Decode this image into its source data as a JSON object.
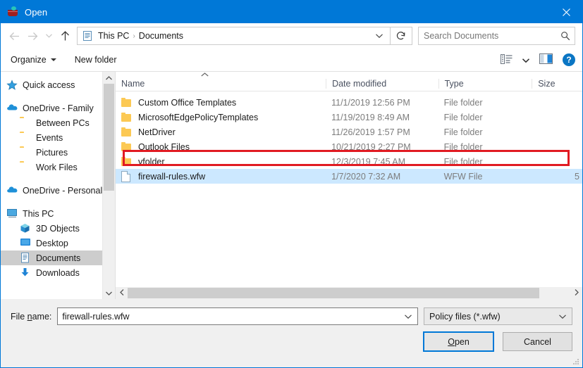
{
  "window": {
    "title": "Open",
    "title_icon": "firewall-basket-icon",
    "close_label": "✕"
  },
  "nav": {
    "back_icon": "back-arrow-icon",
    "forward_icon": "forward-arrow-icon",
    "recent_icon": "chevron-down-icon",
    "up_icon": "up-arrow-icon",
    "breadcrumb_icon": "documents-icon",
    "breadcrumbs": [
      "This PC",
      "Documents"
    ],
    "separator": "›",
    "dropdown_icon": "chevron-down-icon",
    "refresh_icon": "refresh-icon"
  },
  "search": {
    "placeholder": "Search Documents",
    "icon": "search-icon"
  },
  "toolbar": {
    "organize_label": "Organize",
    "new_folder_label": "New folder",
    "view_icon": "view-list-icon",
    "view_caret_icon": "chevron-down-icon",
    "preview_pane_icon": "preview-pane-icon",
    "help_icon": "help-icon",
    "help_glyph": "?"
  },
  "sidebar": {
    "items": [
      {
        "label": "Quick access",
        "icon": "star-icon",
        "indent": false,
        "selected": false
      },
      {
        "label": "OneDrive - Family",
        "icon": "cloud-icon",
        "indent": false,
        "selected": false
      },
      {
        "label": "Between PCs",
        "icon": "folder-icon",
        "indent": true,
        "selected": false
      },
      {
        "label": "Events",
        "icon": "folder-icon",
        "indent": true,
        "selected": false
      },
      {
        "label": "Pictures",
        "icon": "folder-icon",
        "indent": true,
        "selected": false
      },
      {
        "label": "Work Files",
        "icon": "folder-icon",
        "indent": true,
        "selected": false
      },
      {
        "label": "OneDrive - Personal",
        "icon": "cloud-icon",
        "indent": false,
        "selected": false
      },
      {
        "label": "This PC",
        "icon": "monitor-icon",
        "indent": false,
        "selected": false
      },
      {
        "label": "3D Objects",
        "icon": "cube-icon",
        "indent": true,
        "selected": false
      },
      {
        "label": "Desktop",
        "icon": "desktop-icon",
        "indent": true,
        "selected": false
      },
      {
        "label": "Documents",
        "icon": "documents-icon",
        "indent": true,
        "selected": true
      },
      {
        "label": "Downloads",
        "icon": "download-icon",
        "indent": true,
        "selected": false
      }
    ],
    "scroll_up_icon": "chevron-up-icon",
    "scroll_down_icon": "chevron-down-icon"
  },
  "filelist": {
    "sort_indicator_icon": "sort-ascending-icon",
    "columns": [
      "Name",
      "Date modified",
      "Type",
      "Size"
    ],
    "rows": [
      {
        "name": "Custom Office Templates",
        "date": "11/1/2019 12:56 PM",
        "type": "File folder",
        "size": "",
        "icon": "folder-icon",
        "selected": false
      },
      {
        "name": "MicrosoftEdgePolicyTemplates",
        "date": "11/19/2019 8:49 AM",
        "type": "File folder",
        "size": "",
        "icon": "folder-icon",
        "selected": false
      },
      {
        "name": "NetDriver",
        "date": "11/26/2019 1:57 PM",
        "type": "File folder",
        "size": "",
        "icon": "folder-icon",
        "selected": false
      },
      {
        "name": "Outlook Files",
        "date": "10/21/2019 2:27 PM",
        "type": "File folder",
        "size": "",
        "icon": "folder-icon",
        "selected": false
      },
      {
        "name": "vfolder",
        "date": "12/3/2019 7:45 AM",
        "type": "File folder",
        "size": "",
        "icon": "folder-icon",
        "selected": false
      },
      {
        "name": "firewall-rules.wfw",
        "date": "1/7/2020 7:32 AM",
        "type": "WFW File",
        "size": "5",
        "icon": "file-icon",
        "selected": true
      }
    ],
    "highlight_color": "#e11b22",
    "selection_color": "#cce8ff",
    "hscroll_left_icon": "chevron-left-icon",
    "hscroll_right_icon": "chevron-right-icon"
  },
  "footer": {
    "filename_label_pre": "File ",
    "filename_label_accel": "n",
    "filename_label_post": "ame:",
    "filename_value": "firewall-rules.wfw",
    "filename_dropdown_icon": "chevron-down-icon",
    "filter_value": "Policy files (*.wfw)",
    "filter_dropdown_icon": "chevron-down-icon",
    "open_accel": "O",
    "open_rest": "pen",
    "cancel_label": "Cancel",
    "resize_grip_icon": "resize-grip-icon"
  }
}
